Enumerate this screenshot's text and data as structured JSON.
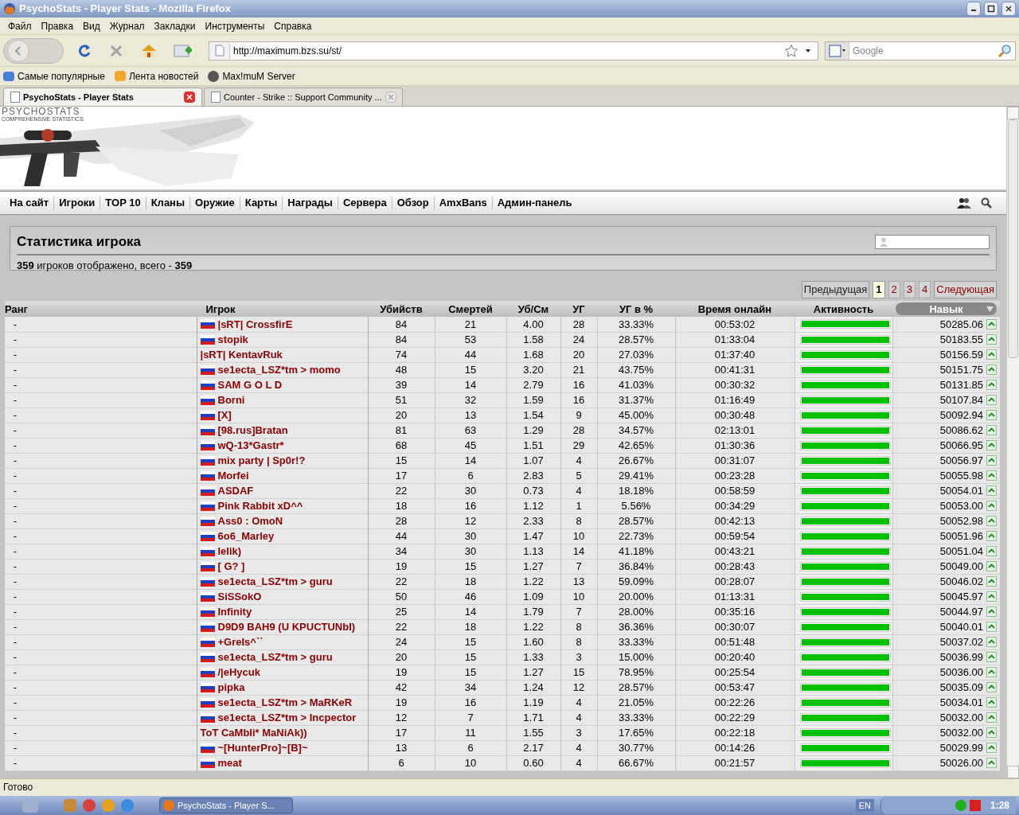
{
  "window": {
    "title": "PsychoStats - Player Stats - Mozilla Firefox"
  },
  "menu": [
    "Файл",
    "Правка",
    "Вид",
    "Журнал",
    "Закладки",
    "Инструменты",
    "Справка"
  ],
  "address": {
    "value": "http://maximum.bzs.su/st/"
  },
  "search": {
    "placeholder": "Google"
  },
  "bookmarks": [
    "Самые популярные",
    "Лента новостей",
    "Max!muM Server"
  ],
  "tabs": [
    {
      "label": "PsychoStats - Player Stats",
      "selected": true
    },
    {
      "label": "Counter - Strike :: Support Community ...",
      "selected": false
    }
  ],
  "logo": {
    "title": "PSYCHOSTATS",
    "subtitle": "COMPREHENSIVE STATISTICS"
  },
  "nav": [
    "На сайт",
    "Игроки",
    "TOP 10",
    "Кланы",
    "Оружие",
    "Карты",
    "Награды",
    "Сервера",
    "Обзор",
    "AmxBans",
    "Админ-панель"
  ],
  "panel": {
    "title": "Статистика игрока",
    "summary": "**359** игроков отображено, всего - **359**"
  },
  "pagination": {
    "prev": "Предыдущая",
    "next": "Следующая",
    "pages": [
      {
        "label": "1",
        "selected": true
      },
      {
        "label": "2",
        "selected": false
      },
      {
        "label": "3",
        "selected": false
      },
      {
        "label": "4",
        "selected": false
      }
    ]
  },
  "table": {
    "columns": [
      {
        "label": "Ранг",
        "sorted": false
      },
      {
        "label": "Игрок",
        "sorted": false
      },
      {
        "label": "Убийств",
        "sorted": false
      },
      {
        "label": "Смертей",
        "sorted": false
      },
      {
        "label": "Уб/См",
        "sorted": false
      },
      {
        "label": "УГ",
        "sorted": false
      },
      {
        "label": "УГ в %",
        "sorted": false
      },
      {
        "label": "Время онлайн",
        "sorted": false
      },
      {
        "label": "Активность",
        "sorted": false
      },
      {
        "label": "Навык",
        "sorted": true
      }
    ],
    "rows": [
      {
        "rank": "-",
        "flag": true,
        "name": "|sRT| CrossfirE",
        "kills": "84",
        "deaths": "21",
        "ratio": "4.00",
        "hs": "28",
        "hs_pct": "33.33%",
        "online": "00:53:02",
        "level": 1,
        "skill": "50285.06"
      },
      {
        "rank": "-",
        "flag": true,
        "name": "stopik",
        "kills": "84",
        "deaths": "53",
        "ratio": "1.58",
        "hs": "24",
        "hs_pct": "28.57%",
        "online": "01:33:04",
        "level": 1,
        "skill": "50183.55"
      },
      {
        "rank": "-",
        "flag": false,
        "name": "|sRT| KentavRuk",
        "kills": "74",
        "deaths": "44",
        "ratio": "1.68",
        "hs": "20",
        "hs_pct": "27.03%",
        "online": "01:37:40",
        "level": 1,
        "skill": "50156.59"
      },
      {
        "rank": "-",
        "flag": true,
        "name": "se1ecta_LSZ*tm > momo",
        "kills": "48",
        "deaths": "15",
        "ratio": "3.20",
        "hs": "21",
        "hs_pct": "43.75%",
        "online": "00:41:31",
        "level": 1,
        "skill": "50151.75"
      },
      {
        "rank": "-",
        "flag": true,
        "name": "SAM G O L D",
        "kills": "39",
        "deaths": "14",
        "ratio": "2.79",
        "hs": "16",
        "hs_pct": "41.03%",
        "online": "00:30:32",
        "level": 1,
        "skill": "50131.85"
      },
      {
        "rank": "-",
        "flag": true,
        "name": "Borni",
        "kills": "51",
        "deaths": "32",
        "ratio": "1.59",
        "hs": "16",
        "hs_pct": "31.37%",
        "online": "01:16:49",
        "level": 1,
        "skill": "50107.84"
      },
      {
        "rank": "-",
        "flag": true,
        "name": "[X]",
        "kills": "20",
        "deaths": "13",
        "ratio": "1.54",
        "hs": "9",
        "hs_pct": "45.00%",
        "online": "00:30:48",
        "level": 1,
        "skill": "50092.94"
      },
      {
        "rank": "-",
        "flag": true,
        "name": "[98.rus]Bratan",
        "kills": "81",
        "deaths": "63",
        "ratio": "1.29",
        "hs": "28",
        "hs_pct": "34.57%",
        "online": "02:13:01",
        "level": 1,
        "skill": "50086.62"
      },
      {
        "rank": "-",
        "flag": true,
        "name": "wQ-13*Gastr*",
        "kills": "68",
        "deaths": "45",
        "ratio": "1.51",
        "hs": "29",
        "hs_pct": "42.65%",
        "online": "01:30:36",
        "level": 1,
        "skill": "50066.95"
      },
      {
        "rank": "-",
        "flag": true,
        "name": "mix party | Sp0r!?",
        "kills": "15",
        "deaths": "14",
        "ratio": "1.07",
        "hs": "4",
        "hs_pct": "26.67%",
        "online": "00:31:07",
        "level": 1,
        "skill": "50056.97"
      },
      {
        "rank": "-",
        "flag": true,
        "name": "Morfei",
        "kills": "17",
        "deaths": "6",
        "ratio": "2.83",
        "hs": "5",
        "hs_pct": "29.41%",
        "online": "00:23:28",
        "level": 1,
        "skill": "50055.98"
      },
      {
        "rank": "-",
        "flag": true,
        "name": "ASDAF",
        "kills": "22",
        "deaths": "30",
        "ratio": "0.73",
        "hs": "4",
        "hs_pct": "18.18%",
        "online": "00:58:59",
        "level": 1,
        "skill": "50054.01"
      },
      {
        "rank": "-",
        "flag": true,
        "name": "Pink Rabbit xD^^",
        "kills": "18",
        "deaths": "16",
        "ratio": "1.12",
        "hs": "1",
        "hs_pct": "5.56%",
        "online": "00:34:29",
        "level": 1,
        "skill": "50053.00"
      },
      {
        "rank": "-",
        "flag": true,
        "name": "Ass0 : OmoN",
        "kills": "28",
        "deaths": "12",
        "ratio": "2.33",
        "hs": "8",
        "hs_pct": "28.57%",
        "online": "00:42:13",
        "level": 1,
        "skill": "50052.98"
      },
      {
        "rank": "-",
        "flag": true,
        "name": "6o6_Marley",
        "kills": "44",
        "deaths": "30",
        "ratio": "1.47",
        "hs": "10",
        "hs_pct": "22.73%",
        "online": "00:59:54",
        "level": 1,
        "skill": "50051.96"
      },
      {
        "rank": "-",
        "flag": true,
        "name": "lelik)",
        "kills": "34",
        "deaths": "30",
        "ratio": "1.13",
        "hs": "14",
        "hs_pct": "41.18%",
        "online": "00:43:21",
        "level": 1,
        "skill": "50051.04"
      },
      {
        "rank": "-",
        "flag": true,
        "name": "[ G? ]",
        "kills": "19",
        "deaths": "15",
        "ratio": "1.27",
        "hs": "7",
        "hs_pct": "36.84%",
        "online": "00:28:43",
        "level": 1,
        "skill": "50049.00"
      },
      {
        "rank": "-",
        "flag": true,
        "name": "se1ecta_LSZ*tm > guru",
        "kills": "22",
        "deaths": "18",
        "ratio": "1.22",
        "hs": "13",
        "hs_pct": "59.09%",
        "online": "00:28:07",
        "level": 1,
        "skill": "50046.02"
      },
      {
        "rank": "-",
        "flag": true,
        "name": "SiSSokO",
        "kills": "50",
        "deaths": "46",
        "ratio": "1.09",
        "hs": "10",
        "hs_pct": "20.00%",
        "online": "01:13:31",
        "level": 1,
        "skill": "50045.97"
      },
      {
        "rank": "-",
        "flag": true,
        "name": "Infinity",
        "kills": "25",
        "deaths": "14",
        "ratio": "1.79",
        "hs": "7",
        "hs_pct": "28.00%",
        "online": "00:35:16",
        "level": 1,
        "skill": "50044.97"
      },
      {
        "rank": "-",
        "flag": true,
        "name": "D9D9 BAH9 (U KPUCTUNbI)",
        "kills": "22",
        "deaths": "18",
        "ratio": "1.22",
        "hs": "8",
        "hs_pct": "36.36%",
        "online": "00:30:07",
        "level": 1,
        "skill": "50040.01"
      },
      {
        "rank": "-",
        "flag": true,
        "name": "+GreIs^``",
        "kills": "24",
        "deaths": "15",
        "ratio": "1.60",
        "hs": "8",
        "hs_pct": "33.33%",
        "online": "00:51:48",
        "level": 1,
        "skill": "50037.02"
      },
      {
        "rank": "-",
        "flag": true,
        "name": "se1ecta_LSZ*tm > guru",
        "kills": "20",
        "deaths": "15",
        "ratio": "1.33",
        "hs": "3",
        "hs_pct": "15.00%",
        "online": "00:20:40",
        "level": 1,
        "skill": "50036.99"
      },
      {
        "rank": "-",
        "flag": true,
        "name": "/|eHycuk",
        "kills": "19",
        "deaths": "15",
        "ratio": "1.27",
        "hs": "15",
        "hs_pct": "78.95%",
        "online": "00:25:54",
        "level": 1,
        "skill": "50036.00"
      },
      {
        "rank": "-",
        "flag": true,
        "name": "pipka",
        "kills": "42",
        "deaths": "34",
        "ratio": "1.24",
        "hs": "12",
        "hs_pct": "28.57%",
        "online": "00:53:47",
        "level": 1,
        "skill": "50035.09"
      },
      {
        "rank": "-",
        "flag": true,
        "name": "se1ecta_LSZ*tm > MaRKeR",
        "kills": "19",
        "deaths": "16",
        "ratio": "1.19",
        "hs": "4",
        "hs_pct": "21.05%",
        "online": "00:22:26",
        "level": 1,
        "skill": "50034.01"
      },
      {
        "rank": "-",
        "flag": true,
        "name": "se1ecta_LSZ*tm > Incpector",
        "kills": "12",
        "deaths": "7",
        "ratio": "1.71",
        "hs": "4",
        "hs_pct": "33.33%",
        "online": "00:22:29",
        "level": 1,
        "skill": "50032.00"
      },
      {
        "rank": "-",
        "flag": false,
        "name": "ToT CaMbIi* MaNiAk))",
        "kills": "17",
        "deaths": "11",
        "ratio": "1.55",
        "hs": "3",
        "hs_pct": "17.65%",
        "online": "00:22:18",
        "level": 1,
        "skill": "50032.00"
      },
      {
        "rank": "-",
        "flag": true,
        "name": "~[HunterPro]~[B]~",
        "kills": "13",
        "deaths": "6",
        "ratio": "2.17",
        "hs": "4",
        "hs_pct": "30.77%",
        "online": "00:14:26",
        "level": 1,
        "skill": "50029.99"
      },
      {
        "rank": "-",
        "flag": true,
        "name": "meat",
        "kills": "6",
        "deaths": "10",
        "ratio": "0.60",
        "hs": "4",
        "hs_pct": "66.67%",
        "online": "00:21:57",
        "level": 1,
        "skill": "50026.00"
      }
    ]
  },
  "status_bar": {
    "text": "Готово"
  },
  "taskbar": {
    "task": "PsychoStats - Player S...",
    "language": "EN",
    "clock": "1:28"
  }
}
